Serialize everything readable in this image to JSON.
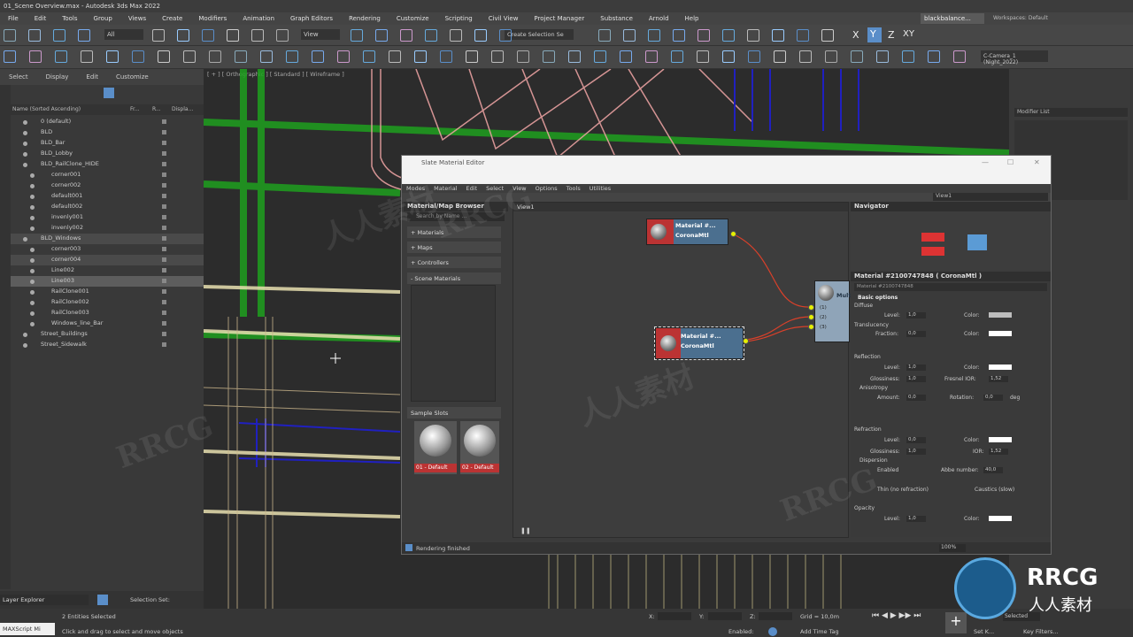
{
  "window": {
    "title": "01_Scene Overview.max - Autodesk 3ds Max 2022"
  },
  "menu": [
    "File",
    "Edit",
    "Tools",
    "Group",
    "Views",
    "Create",
    "Modifiers",
    "Animation",
    "Graph Editors",
    "Rendering",
    "Customize",
    "Scripting",
    "Civil View",
    "Project Manager",
    "Substance",
    "Arnold",
    "Help"
  ],
  "account": {
    "name": "blackbalance...",
    "workspaces_label": "Workspaces:",
    "workspace": "Default"
  },
  "toolbar": {
    "filter_value": "All",
    "view_dropdown": "View",
    "selection_set": "Create Selection Se",
    "object_name": "C-Camera_1 (Night_2022)"
  },
  "scene_explorer": {
    "tabs": [
      "Select",
      "Display",
      "Edit",
      "Customize"
    ],
    "columns": [
      "Name (Sorted Ascending)",
      "Fr...",
      "R...",
      "Displa..."
    ],
    "rows": [
      {
        "name": "0 (default)",
        "indent": 0
      },
      {
        "name": "BLD",
        "indent": 0
      },
      {
        "name": "BLD_Bar",
        "indent": 0
      },
      {
        "name": "BLD_Lobby",
        "indent": 0
      },
      {
        "name": "BLD_RailClone_HIDE",
        "indent": 0
      },
      {
        "name": "corner001",
        "indent": 1
      },
      {
        "name": "corner002",
        "indent": 1
      },
      {
        "name": "default001",
        "indent": 1
      },
      {
        "name": "default002",
        "indent": 1
      },
      {
        "name": "invenly001",
        "indent": 1
      },
      {
        "name": "invenly002",
        "indent": 1
      },
      {
        "name": "BLD_Windows",
        "indent": 0
      },
      {
        "name": "corner003",
        "indent": 1
      },
      {
        "name": "corner004",
        "indent": 1
      },
      {
        "name": "Line002",
        "indent": 1
      },
      {
        "name": "Line003",
        "indent": 1
      },
      {
        "name": "RailClone001",
        "indent": 1
      },
      {
        "name": "RailClone002",
        "indent": 1
      },
      {
        "name": "RailClone003",
        "indent": 1
      },
      {
        "name": "Windows_line_Bar",
        "indent": 1
      },
      {
        "name": "Street_Buildings",
        "indent": 0
      },
      {
        "name": "Street_Sidewalk",
        "indent": 0
      }
    ],
    "footer_label": "Layer Explorer",
    "selection_set_label": "Selection Set:"
  },
  "viewport": {
    "label": "[ + ] [ Orthographic ] [ Standard ] [ Wireframe ]"
  },
  "slate": {
    "title": "Slate Material Editor",
    "menu": [
      "Modes",
      "Material",
      "Edit",
      "Select",
      "View",
      "Options",
      "Tools",
      "Utilities"
    ],
    "view_dropdown": "View1",
    "browser_title": "Material/Map Browser",
    "search_placeholder": "Search by Name ...",
    "browser_items": [
      "+ Materials",
      "+ Maps",
      "+ Controllers",
      "- Scene Materials"
    ],
    "sample_slots_title": "Sample Slots",
    "slots": [
      "01 - Default",
      "02 - Default"
    ],
    "view_tab": "View1",
    "node1_title": "Material #...",
    "node1_type": "CoronaMtl",
    "node2_title": "Material #...",
    "node2_type": "CoronaMtl",
    "multi_node": "Mult",
    "multi_ports": [
      "(1)",
      "(2)",
      "(3)"
    ],
    "navigator": "Navigator",
    "params_title": "Material #2100747848  ( CoronaMtl )",
    "params_sub": "Material #2100747848",
    "rollout": "Basic options",
    "diffuse": "Diffuse",
    "level": "Level:",
    "color": "Color:",
    "translucency": "Translucency",
    "fraction": "Fraction:",
    "reflection": "Reflection",
    "glossiness": "Glossiness:",
    "fresnel": "Fresnel IOR:",
    "anisotropy": "Anisotropy",
    "amount": "Amount:",
    "rotation": "Rotation:",
    "deg": "deg",
    "refraction": "Refraction",
    "ior": "IOR:",
    "dispersion": "Dispersion",
    "enabled": "Enabled",
    "abbe": "Abbe number:",
    "thin": "Thin (no refraction)",
    "caustics": "Caustics (slow)",
    "opacity": "Opacity",
    "val_one": "1,0",
    "val_zero": "0,0",
    "val_ior": "1,52",
    "val_abbe": "40,0",
    "status": "Rendering finished",
    "zoom": "100%"
  },
  "command_panel": {
    "modifier_list": "Modifier List"
  },
  "status_bar": {
    "selected": "2 Entities Selected",
    "prompt": "Click and drag to select and move objects",
    "maxscript": "MAXScript Mi",
    "x_label": "X:",
    "y_label": "Y:",
    "z_label": "Z:",
    "grid": "Grid = 10,0m",
    "enabled_label": "Enabled:",
    "add_time_tag": "Add Time Tag",
    "set_key": "Set K...",
    "key_filters": "Key Filters...",
    "selected_dd": "Selected"
  },
  "watermark": {
    "brand": "RRCG",
    "chinese": "人人素材"
  },
  "colors": {
    "accent": "#5a8ec9",
    "node_red": "#b33333",
    "port": "#e6f000",
    "green": "#1fa01f",
    "pink": "#e8a0a0",
    "blue": "#2020c0"
  }
}
